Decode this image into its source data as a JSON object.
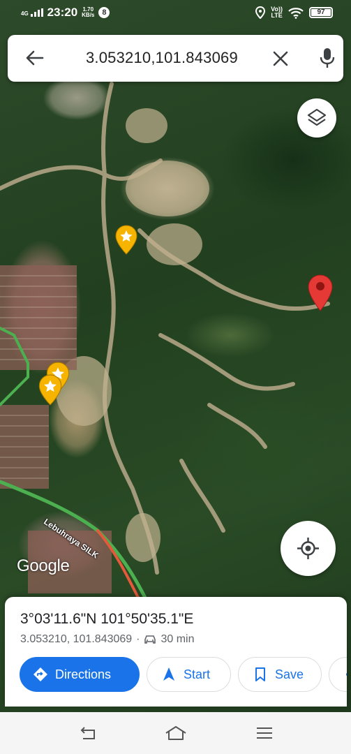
{
  "status_bar": {
    "network": "4G",
    "time": "23:20",
    "speed_value": "1.70",
    "speed_unit": "KB/s",
    "notification_count": "8",
    "volte": "Vo))",
    "lte": "LTE",
    "battery": "97",
    "icons": [
      "signal-icon",
      "location-icon",
      "wifi-icon",
      "battery-icon"
    ]
  },
  "search": {
    "query": "3.053210,101.843069",
    "icons": [
      "back-arrow-icon",
      "clear-icon",
      "mic-icon"
    ]
  },
  "map": {
    "road_label": "Lebuhraya SILK",
    "logo": "Google",
    "markers": [
      "starred-place-marker",
      "dropped-pin-marker"
    ],
    "colors": {
      "pin": "#e53935",
      "star_marker": "#f6b400",
      "road": "#4caf50",
      "road_traffic": "#e35a3b"
    }
  },
  "place_sheet": {
    "title": "3°03'11.6\"N 101°50'35.1\"E",
    "coords": "3.053210, 101.843069",
    "separator": "·",
    "drive_time": "30 min",
    "actions": [
      {
        "label": "Directions",
        "icon": "directions-icon"
      },
      {
        "label": "Start",
        "icon": "navigation-arrow-icon"
      },
      {
        "label": "Save",
        "icon": "bookmark-icon"
      },
      {
        "label": "",
        "icon": "more-icon"
      }
    ]
  },
  "accent_color": "#1a73e8",
  "nav_bar": {
    "icons": [
      "back-icon",
      "home-icon",
      "menu-icon"
    ]
  }
}
